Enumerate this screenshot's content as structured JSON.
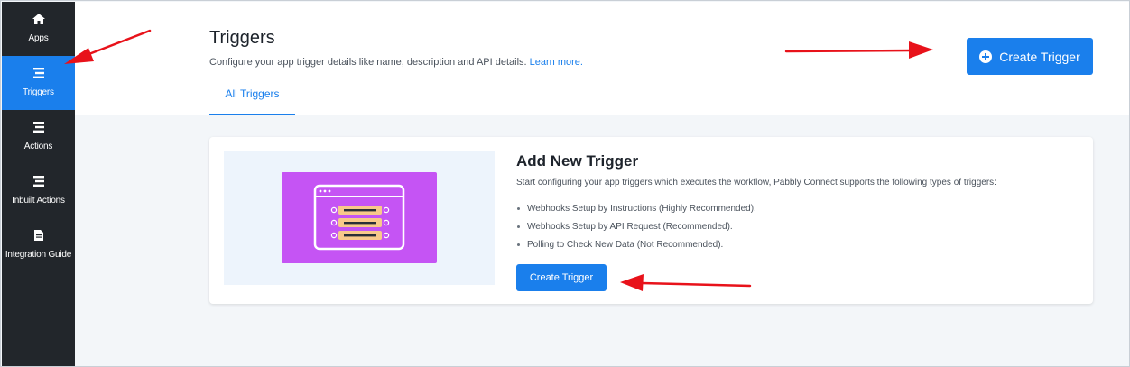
{
  "sidebar": {
    "items": [
      {
        "label": "Apps",
        "icon": "home-icon",
        "active": false
      },
      {
        "label": "Triggers",
        "icon": "list-icon",
        "active": true
      },
      {
        "label": "Actions",
        "icon": "list-icon",
        "active": false
      },
      {
        "label": "Inbuilt Actions",
        "icon": "list-icon",
        "active": false
      },
      {
        "label": "Integration Guide",
        "icon": "document-icon",
        "active": false
      }
    ]
  },
  "header": {
    "title": "Triggers",
    "description": "Configure your app trigger details like name, description and API details.",
    "learn_more": "Learn more.",
    "create_button": "Create Trigger",
    "tabs": [
      {
        "label": "All Triggers",
        "active": true
      }
    ]
  },
  "card": {
    "title": "Add New Trigger",
    "description": "Start configuring your app triggers which executes the workflow, Pabbly Connect supports the following types of triggers:",
    "list": [
      "Webhooks Setup by Instructions (Highly Recommended).",
      "Webhooks Setup by API Request (Recommended).",
      "Polling to Check New Data (Not Recommended)."
    ],
    "button": "Create Trigger",
    "illustration": "trigger-list-illustration"
  },
  "colors": {
    "accent": "#1a7fec",
    "sidebar_bg": "#22262b",
    "illustration_bg": "#c554f4",
    "annotation_arrow": "#e8121a"
  }
}
